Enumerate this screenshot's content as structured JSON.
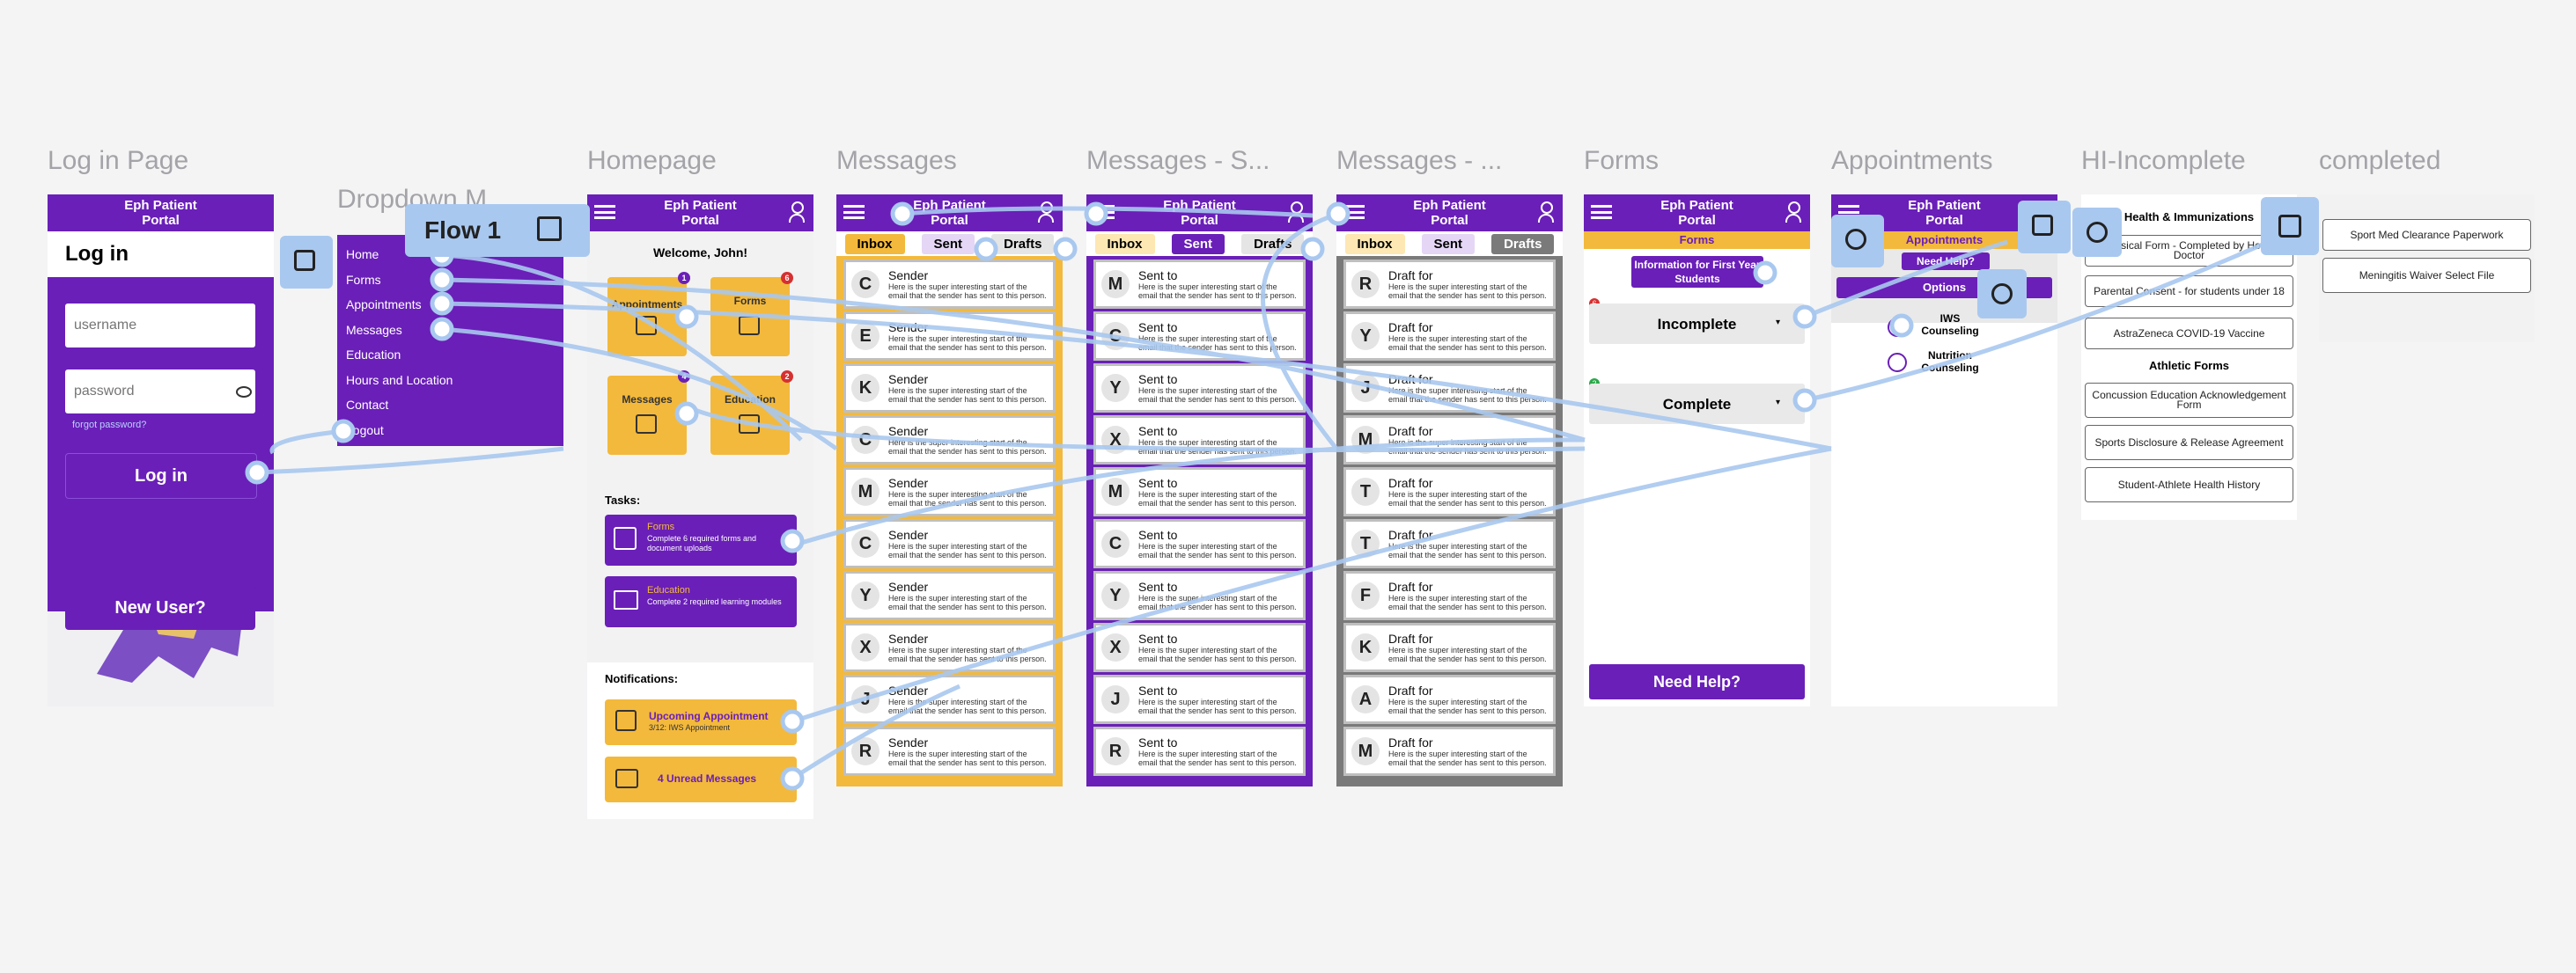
{
  "frames": {
    "login": "Log in Page",
    "dropdown": "Dropdown M...",
    "home": "Homepage",
    "messages": "Messages",
    "sent": "Messages - S...",
    "drafts": "Messages - ...",
    "forms": "Forms",
    "appointments": "Appointments",
    "hi": "HI-Incomplete",
    "completed": "completed"
  },
  "flow_label": "Flow 1",
  "portal_title": "Eph Patient Portal",
  "login": {
    "heading": "Log in",
    "username_placeholder": "username",
    "password_placeholder": "password",
    "forgot": "forgot password?",
    "login_button": "Log in",
    "new_user_button": "New User?"
  },
  "dropdown": {
    "items": [
      "Home",
      "Forms",
      "Appointments",
      "Messages",
      "Education",
      "Hours and Location",
      "Contact",
      "Logout"
    ]
  },
  "home": {
    "welcome": "Welcome, John!",
    "tiles": [
      {
        "label": "Appointments",
        "badge": "1",
        "badge_color": "#6a1fb8"
      },
      {
        "label": "Forms",
        "badge": "6",
        "badge_color": "#d63031"
      },
      {
        "label": "Messages",
        "badge": "4",
        "badge_color": "#6a1fb8"
      },
      {
        "label": "Education",
        "badge": "2",
        "badge_color": "#d63031"
      }
    ],
    "tasks_heading": "Tasks:",
    "tasks": [
      {
        "title": "Forms",
        "desc": "Complete 6 required forms and document uploads"
      },
      {
        "title": "Education",
        "desc": "Complete 2 required learning modules"
      }
    ],
    "notifications_heading": "Notifications:",
    "notifications": [
      {
        "title": "Upcoming Appointment",
        "desc": "3/12: IWS Appointment"
      },
      {
        "title": "4 Unread Messages",
        "desc": ""
      }
    ]
  },
  "tabs": {
    "inbox": "Inbox",
    "sent": "Sent",
    "drafts": "Drafts"
  },
  "inbox": {
    "letters": [
      "C",
      "E",
      "K",
      "C",
      "M",
      "C",
      "Y",
      "X",
      "J",
      "R"
    ],
    "title": "Sender",
    "preview": "Here is the super interesting start of the email that the sender has sent to this person."
  },
  "sent": {
    "letters": [
      "M",
      "C",
      "Y",
      "X",
      "M",
      "C",
      "Y",
      "X",
      "J",
      "R"
    ],
    "title": "Sent to",
    "preview": "Here is the super interesting start of the email that the sender has sent to this person."
  },
  "drafts": {
    "letters": [
      "R",
      "Y",
      "J",
      "M",
      "T",
      "T",
      "F",
      "K",
      "A",
      "M"
    ],
    "title": "Draft for",
    "preview": "Here is the super interesting start of the email that the sender has sent to this person."
  },
  "forms": {
    "bar": "Forms",
    "info": "Information for First Year Students",
    "incomplete": "Incomplete",
    "incomplete_badge": "6",
    "complete": "Complete",
    "complete_badge": "2",
    "help": "Need Help?"
  },
  "appointments": {
    "bar": "Appointments",
    "need_help": "Need Help?",
    "options": "Options",
    "opts": [
      "IWS Counseling",
      "Nutrition Counseling"
    ]
  },
  "hi": {
    "heading": "Health & Immunizations",
    "items": [
      "Physical Form - Completed by Home Doctor",
      "Parental Consent - for students under 18",
      "AstraZeneca COVID-19 Vaccine"
    ],
    "athletic_heading": "Athletic Forms",
    "athletic": [
      "Concussion Education Acknowledgement Form",
      "Sports Disclosure & Release Agreement",
      "Student-Athlete Health History"
    ]
  },
  "completed": {
    "items": [
      "Sport Med Clearance Paperwork",
      "Meningitis Waiver Select File"
    ]
  }
}
